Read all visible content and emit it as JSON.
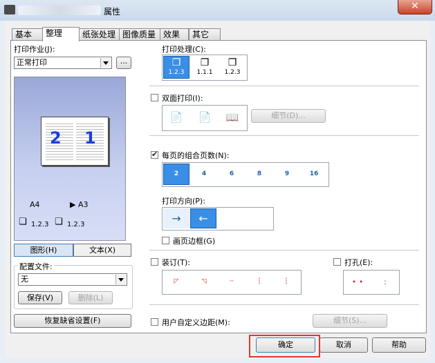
{
  "window": {
    "title": "属性",
    "close_glyph": "✕"
  },
  "tabs": [
    "基本",
    "整理",
    "纸张处理",
    "图像质量",
    "效果",
    "其它"
  ],
  "print_job": {
    "label": "打印作业(J):",
    "value": "正常打印",
    "more": "..."
  },
  "preview": {
    "left_number": "2",
    "right_number": "1",
    "size_from": "A4",
    "size_to": "A3",
    "order_left": "1.2.3",
    "order_right": "1.2.3"
  },
  "view_toggle": {
    "graphic": "图形(H)",
    "text": "文本(X)"
  },
  "profile": {
    "label": "配置文件:",
    "value": "无",
    "save": "保存(V)",
    "delete": "删除(L)"
  },
  "restore_default": "恢复缺省设置(F)",
  "print_process": {
    "label": "打印处理(C):",
    "options": [
      "1.2.3",
      "1.1.1",
      "1.2.3"
    ]
  },
  "duplex": {
    "label": "双面打印(I):",
    "details": "细节(D)..."
  },
  "pages_per_sheet": {
    "label": "每页的组合页数(N):",
    "options": [
      "2",
      "4",
      "6",
      "8",
      "9",
      "16"
    ]
  },
  "orientation": {
    "label": "打印方向(P):",
    "arrows": [
      "→",
      "←"
    ]
  },
  "page_border": "画页边框(G)",
  "binding": {
    "label": "装订(T):"
  },
  "punch": {
    "label": "打孔(E):"
  },
  "custom_margin": {
    "label": "用户自定义边距(M):",
    "details": "细节(S)..."
  },
  "footer": {
    "ok": "确定",
    "cancel": "取消",
    "help": "帮助"
  }
}
